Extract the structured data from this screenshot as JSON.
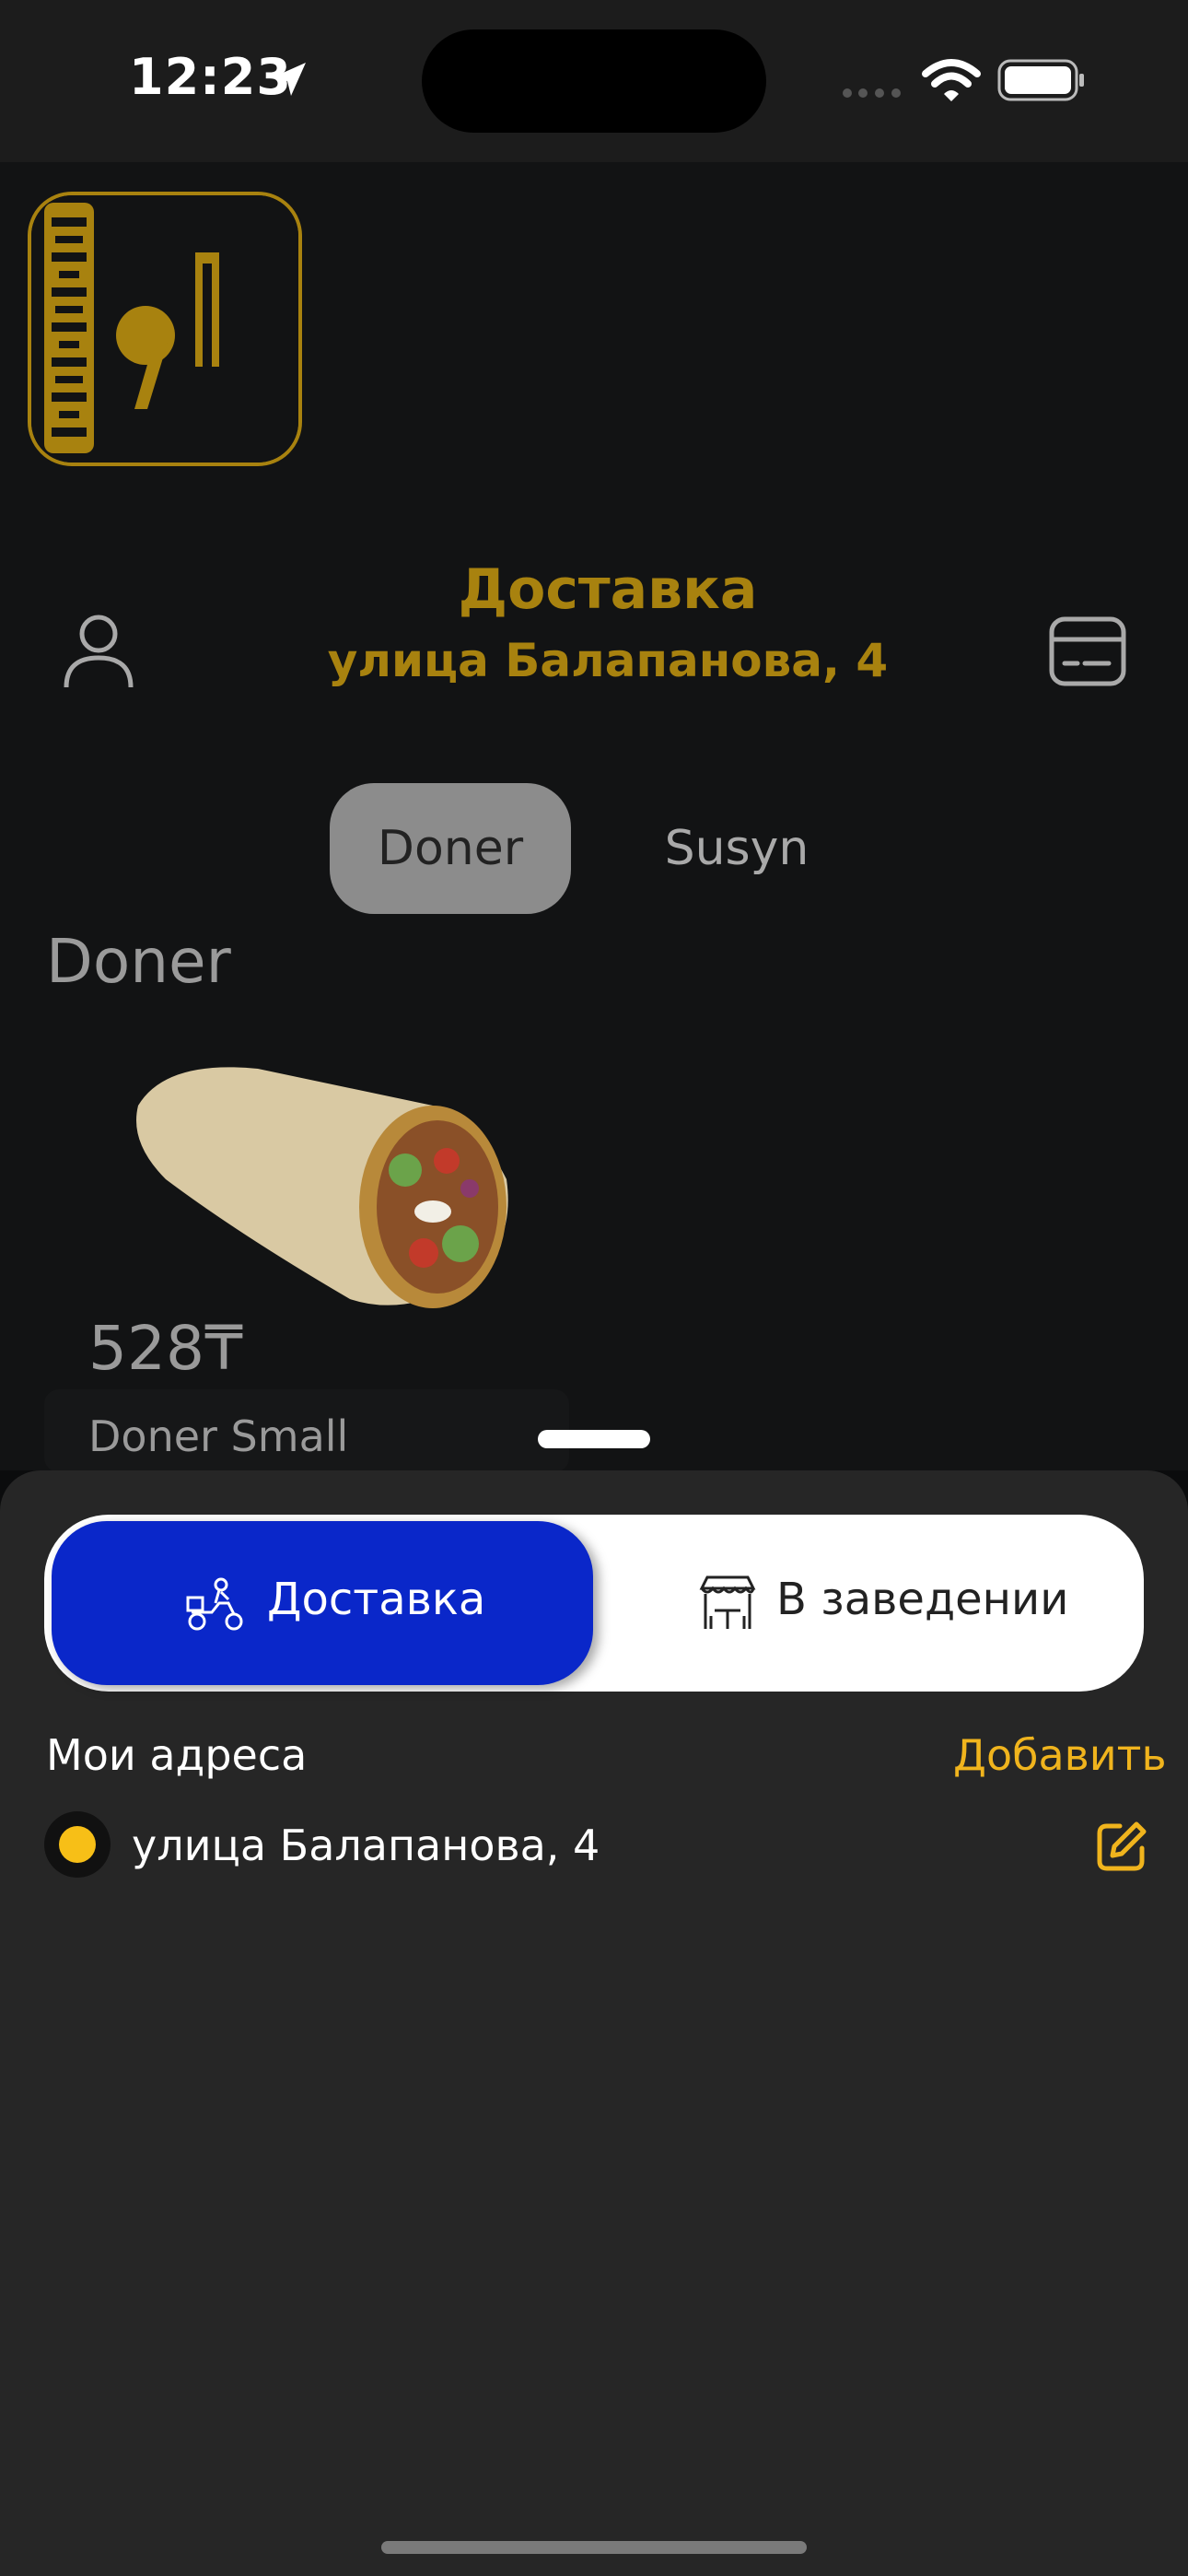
{
  "status_bar": {
    "time": "12:23",
    "icons": [
      "location-arrow-icon",
      "signal-icon",
      "wifi-icon",
      "battery-icon"
    ]
  },
  "colors": {
    "accent_gold": "#a8820f",
    "link_yellow": "#f0b41d",
    "primary_blue": "#0a27c9",
    "background": "#121314",
    "sheet": "#262626"
  },
  "header": {
    "title": "Доставка",
    "address": "улица Балапанова, 4",
    "left_icon": "user-icon",
    "right_icon": "card-icon"
  },
  "category_tabs": [
    {
      "label": "Doner",
      "selected": true
    },
    {
      "label": "Susyn",
      "selected": false
    }
  ],
  "section": {
    "title": "Doner",
    "products": [
      {
        "name": "Doner Small",
        "price": "528₸"
      }
    ]
  },
  "sheet": {
    "segment": [
      {
        "label": "Доставка",
        "icon": "scooter-icon",
        "selected": true
      },
      {
        "label": "В заведении",
        "icon": "cafe-icon",
        "selected": false
      }
    ],
    "addresses_title": "Мои адреса",
    "add_label": "Добавить",
    "addresses": [
      {
        "text": "улица Балапанова, 4",
        "selected": true
      }
    ]
  }
}
